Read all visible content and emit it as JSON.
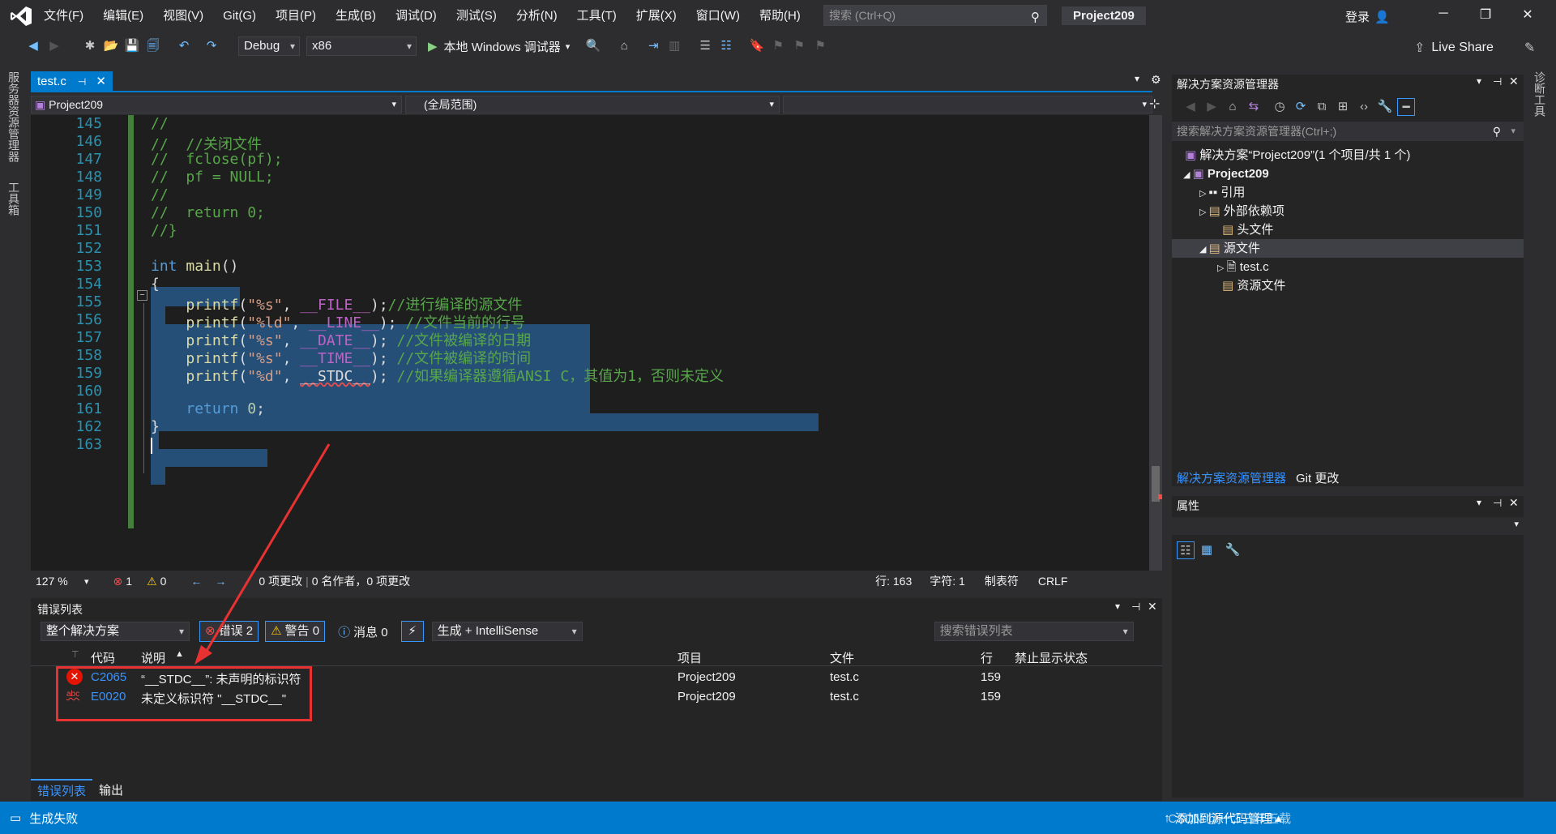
{
  "titlebar": {
    "menus": [
      "文件(F)",
      "编辑(E)",
      "视图(V)",
      "Git(G)",
      "项目(P)",
      "生成(B)",
      "调试(D)",
      "测试(S)",
      "分析(N)",
      "工具(T)",
      "扩展(X)",
      "窗口(W)",
      "帮助(H)"
    ],
    "search_placeholder": "搜索 (Ctrl+Q)",
    "project_title": "Project209",
    "login": "登录"
  },
  "toolbar": {
    "config": "Debug",
    "platform": "x86",
    "debugger": "本地 Windows 调试器",
    "live_share": "Live Share"
  },
  "left_strip": {
    "server_explorer": "服务器资源管理器",
    "toolbox": "工具箱"
  },
  "right_strip": {
    "diagnostics": "诊断工具"
  },
  "editor": {
    "tab": "test.c",
    "nav_project": "Project209",
    "nav_scope": "(全局范围)",
    "zoom": "127 %",
    "errors_count": "1",
    "warnings_count": "0",
    "changes": "0 项更改",
    "authors": "0 名作者，0 项更改",
    "line": "行: 163",
    "col": "字符: 1",
    "tabs": "制表符",
    "eol": "CRLF",
    "line_numbers": [
      "145",
      "146",
      "147",
      "148",
      "149",
      "150",
      "151",
      "152",
      "153",
      "154",
      "155",
      "156",
      "157",
      "158",
      "159",
      "160",
      "161",
      "162",
      "163"
    ]
  },
  "errorlist": {
    "title": "错误列表",
    "scope": "整个解决方案",
    "errors_btn": "错误 2",
    "warnings_btn": "警告 0",
    "messages_btn": "消息 0",
    "source": "生成 + IntelliSense",
    "search_placeholder": "搜索错误列表",
    "columns": {
      "code": "代码",
      "desc": "说明",
      "project": "项目",
      "file": "文件",
      "line": "行",
      "suppress": "禁止显示状态"
    },
    "rows": [
      {
        "code": "C2065",
        "desc": "“__STDC__”: 未声明的标识符",
        "project": "Project209",
        "file": "test.c",
        "line": "159"
      },
      {
        "code": "E0020",
        "desc": "未定义标识符 \"__STDC__\"",
        "project": "Project209",
        "file": "test.c",
        "line": "159"
      }
    ],
    "tabs": [
      "错误列表",
      "输出"
    ]
  },
  "solution": {
    "title": "解决方案资源管理器",
    "search_placeholder": "搜索解决方案资源管理器(Ctrl+;)",
    "tree": {
      "solution": "解决方案“Project209”(1 个项目/共 1 个)",
      "project": "Project209",
      "references": "引用",
      "external": "外部依赖项",
      "headers": "头文件",
      "sources": "源文件",
      "testc": "test.c",
      "resources": "资源文件"
    },
    "tabs": [
      "解决方案资源管理器",
      "Git 更改"
    ]
  },
  "properties": {
    "title": "属性"
  },
  "statusbar": {
    "left": "生成失败",
    "right": "添加到源代码管理",
    "watermark": "CSDN @一二三年五载"
  }
}
